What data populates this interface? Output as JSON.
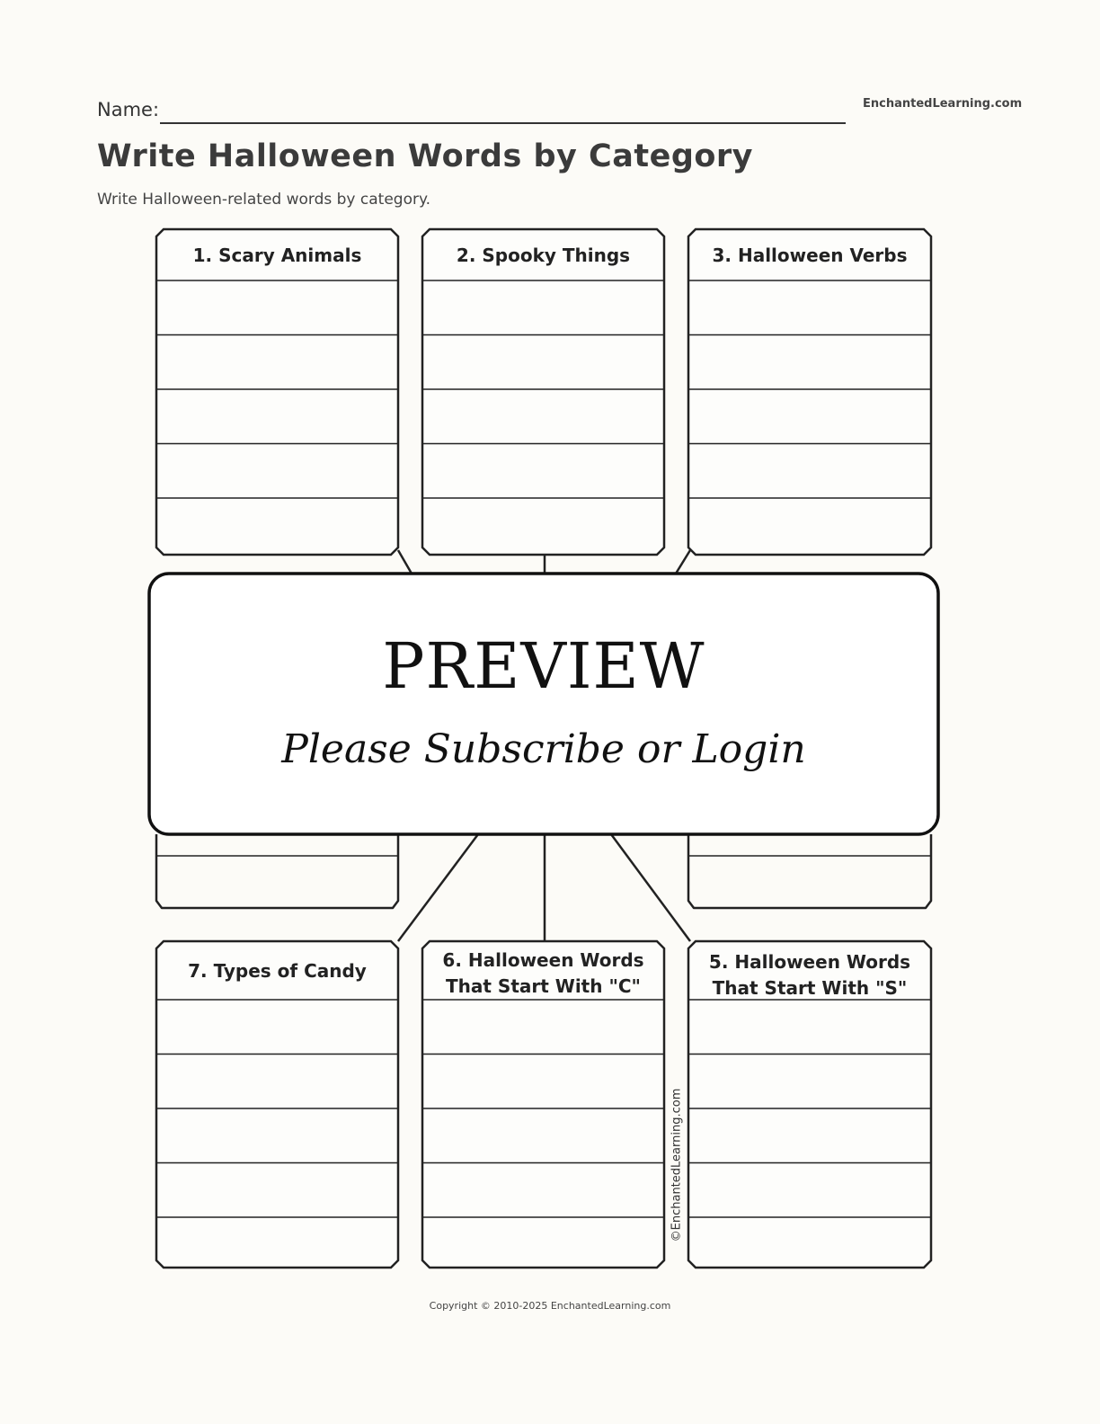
{
  "header": {
    "name_label": "Name:",
    "brand": "EnchantedLearning.com",
    "title": "Write Halloween Words by Category",
    "subtitle": "Write Halloween-related words by category."
  },
  "boxes": [
    {
      "title": "1. Scary Animals",
      "lines": 5
    },
    {
      "title": "2. Spooky Things",
      "lines": 5
    },
    {
      "title": "3.  Halloween Verbs",
      "lines": 5
    },
    {
      "title": "5.  Halloween Words That Start With \"S\"",
      "lines": 5
    },
    {
      "title": "6. Halloween Words That Start With \"C\"",
      "lines": 5
    },
    {
      "title": "7. Types of Candy",
      "lines": 5
    }
  ],
  "titles": {
    "box1": "1. Scary Animals",
    "box2": "2. Spooky Things",
    "box3": "3.  Halloween Verbs",
    "box5_line1": "5.  Halloween Words",
    "box5_line2": "That Start With \"S\"",
    "box6_line1": "6. Halloween Words",
    "box6_line2": "That Start With \"C\"",
    "box7": "7. Types of Candy"
  },
  "preview": {
    "title": "PREVIEW",
    "subtitle": "Please Subscribe or Login"
  },
  "footer": {
    "side_credit": "©EnchantedLearning.com",
    "copyright": "Copyright © 2010-2025 EnchantedLearning.com"
  }
}
